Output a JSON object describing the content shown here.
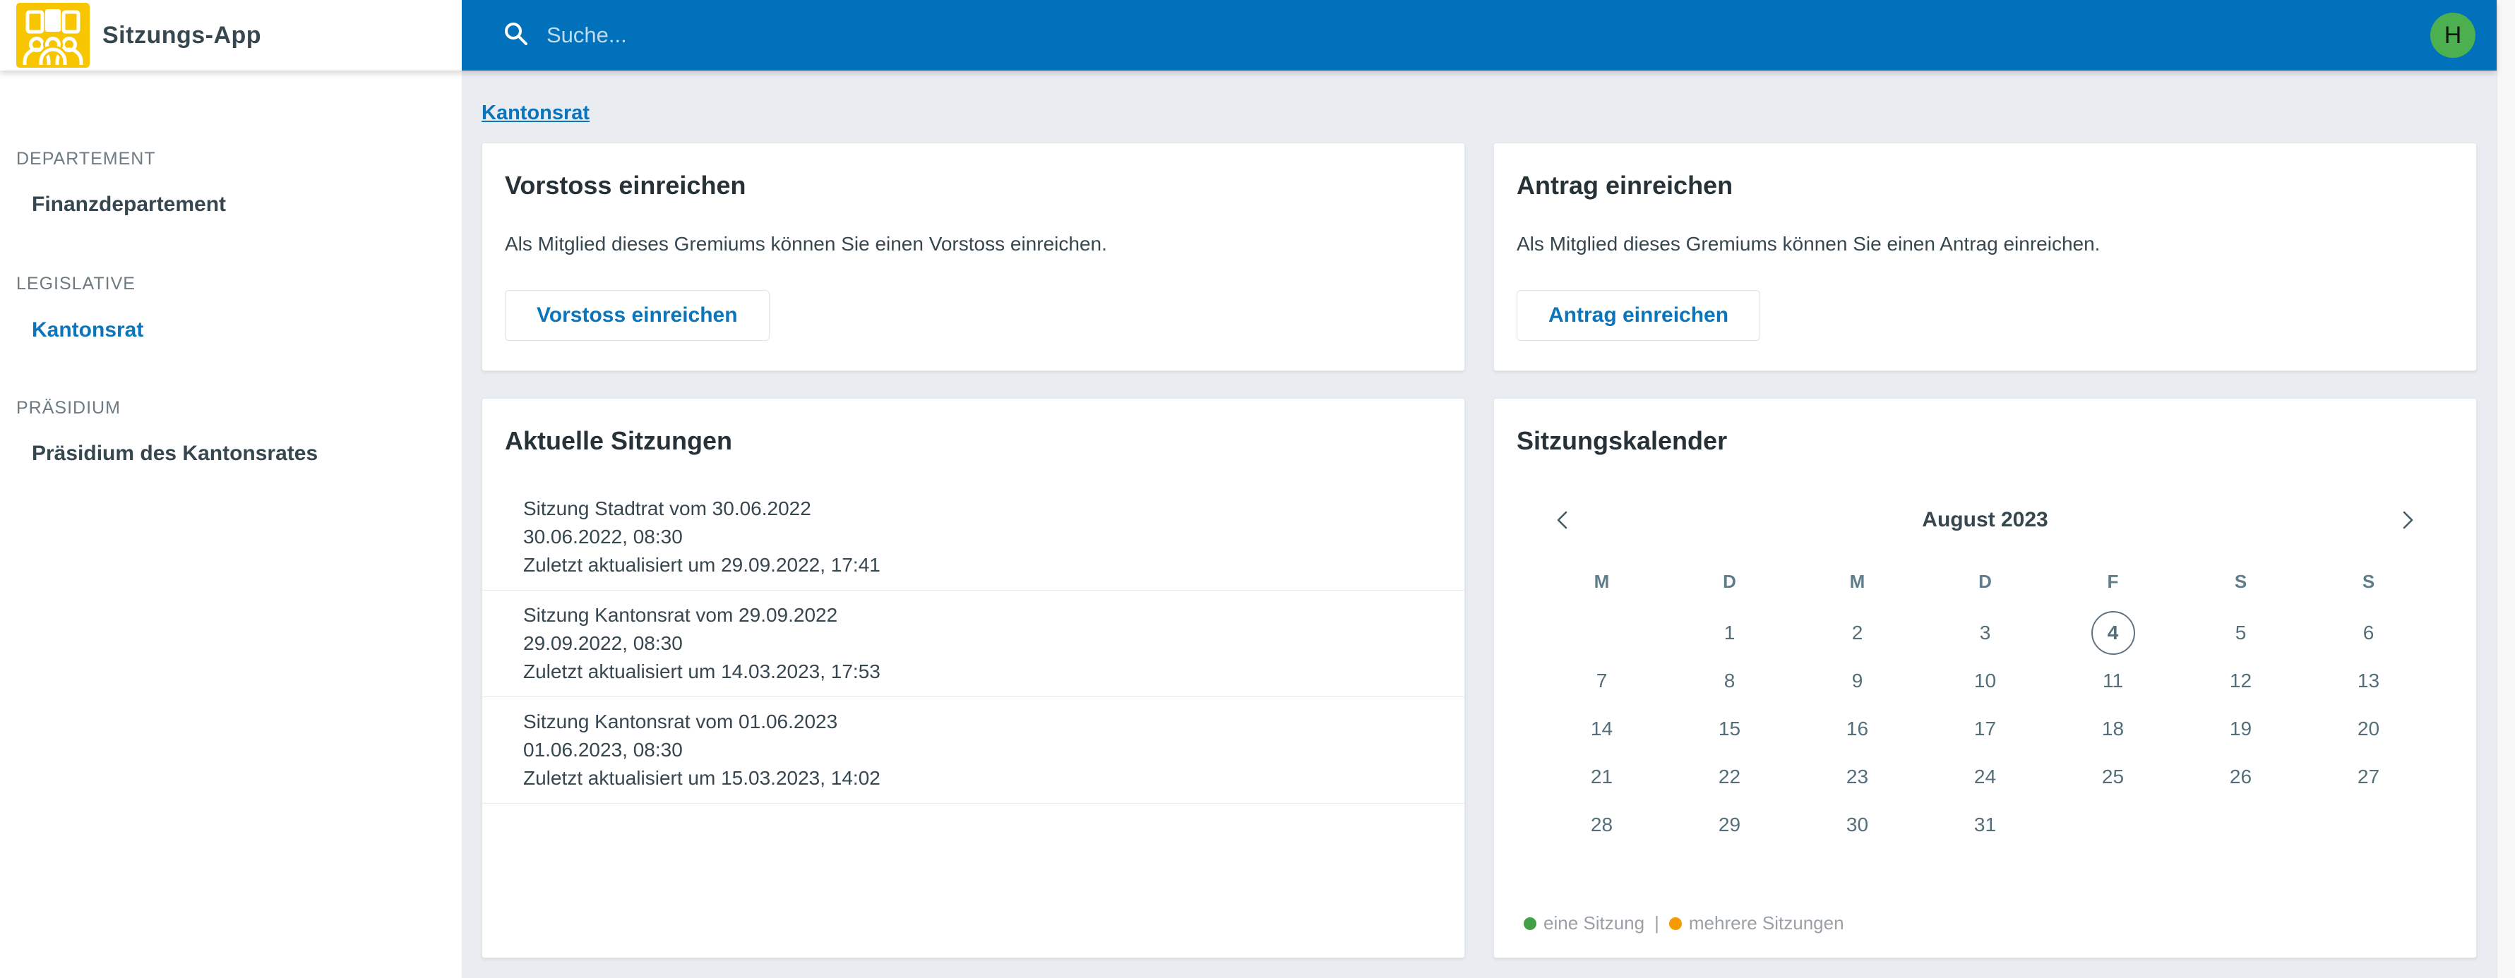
{
  "app": {
    "title": "Sitzungs-App"
  },
  "header": {
    "search_placeholder": "Suche...",
    "avatar_initial": "H"
  },
  "colors": {
    "header_blue": "#0071ba",
    "logo_yellow": "#f7c600",
    "avatar_green": "#4caf50",
    "accent_blue": "#0b74ba",
    "legend_green": "#43a047",
    "legend_orange": "#f59b00",
    "content_background": "#e9edf1"
  },
  "icons": {
    "logo": "meeting-people-icon",
    "search": "magnifier-icon",
    "calendar_prev": "chevron-left-icon",
    "calendar_next": "chevron-right-icon"
  },
  "sidebar": {
    "sections": [
      {
        "label": "DEPARTEMENT",
        "items": [
          {
            "label": "Finanzdepartement",
            "active": false
          }
        ]
      },
      {
        "label": "LEGISLATIVE",
        "items": [
          {
            "label": "Kantonsrat",
            "active": true
          }
        ]
      },
      {
        "label": "PRÄSIDIUM",
        "items": [
          {
            "label": "Präsidium des Kantonsrates",
            "active": false
          }
        ]
      }
    ]
  },
  "breadcrumb": {
    "label": "Kantonsrat"
  },
  "vorstoss_card": {
    "title": "Vorstoss einreichen",
    "description": "Als Mitglied dieses Gremiums können Sie einen Vorstoss einreichen.",
    "button_label": "Vorstoss einreichen"
  },
  "antrag_card": {
    "title": "Antrag einreichen",
    "description": "Als Mitglied dieses Gremiums können Sie einen Antrag einreichen.",
    "button_label": "Antrag einreichen"
  },
  "sitzungen_card": {
    "title": "Aktuelle Sitzungen",
    "items": [
      {
        "title": "Sitzung Stadtrat vom 30.06.2022",
        "datetime": "30.06.2022, 08:30",
        "updated": "Zuletzt aktualisiert um 29.09.2022, 17:41"
      },
      {
        "title": "Sitzung Kantonsrat vom 29.09.2022",
        "datetime": "29.09.2022, 08:30",
        "updated": "Zuletzt aktualisiert um 14.03.2023, 17:53"
      },
      {
        "title": "Sitzung Kantonsrat vom 01.06.2023",
        "datetime": "01.06.2023, 08:30",
        "updated": "Zuletzt aktualisiert um 15.03.2023, 14:02"
      }
    ]
  },
  "calendar_card": {
    "title": "Sitzungskalender",
    "month_label": "August 2023",
    "today_day": "4",
    "weekdays": [
      "M",
      "D",
      "M",
      "D",
      "F",
      "S",
      "S"
    ],
    "weeks": [
      [
        "",
        "1",
        "2",
        "3",
        "4",
        "5",
        "6"
      ],
      [
        "7",
        "8",
        "9",
        "10",
        "11",
        "12",
        "13"
      ],
      [
        "14",
        "15",
        "16",
        "17",
        "18",
        "19",
        "20"
      ],
      [
        "21",
        "22",
        "23",
        "24",
        "25",
        "26",
        "27"
      ],
      [
        "28",
        "29",
        "30",
        "31",
        "",
        "",
        ""
      ]
    ],
    "legend": {
      "single_label": "eine Sitzung",
      "separator": "|",
      "multiple_label": "mehrere Sitzungen"
    }
  }
}
